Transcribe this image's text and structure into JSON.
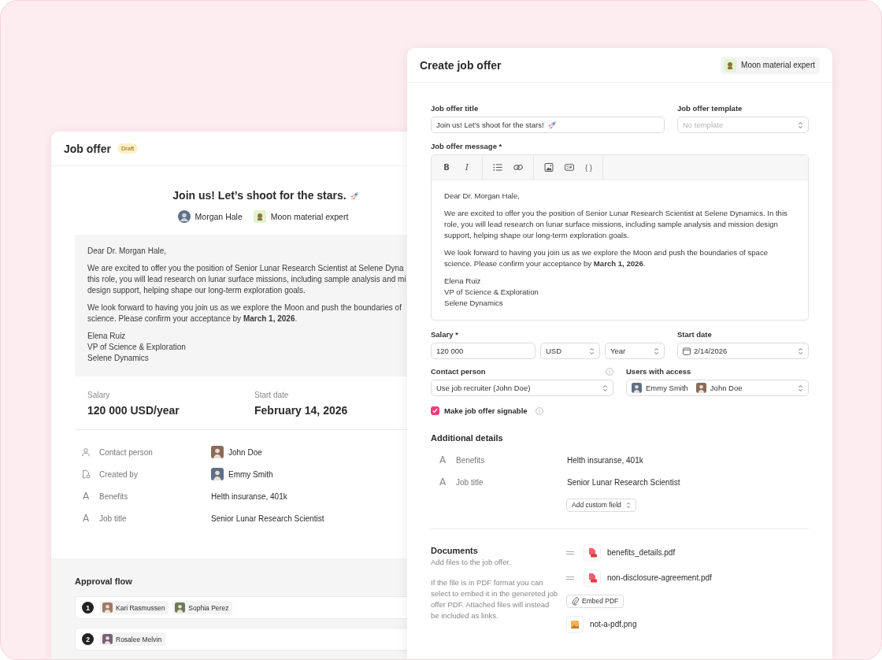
{
  "back_window": {
    "title": "Job offer",
    "badge": "Draft",
    "offer_title": "Join us! Let’s shoot for the stars.",
    "candidate": "Morgan Hale",
    "role": "Moon material expert",
    "letter": [
      {
        "lines": [
          "Dear Dr. Morgan Hale,"
        ]
      },
      {
        "lines": [
          "We are excited to offer you the position of Senior Lunar Research Scientist at Selene Dyna",
          "this role, you will lead research on lunar surface missions, including sample analysis and mi",
          "design support, helping shape our long-term exploration goals."
        ]
      },
      {
        "lines": [
          "We look forward to having you join us as we explore the Moon and push the boundaries of",
          "science. Please confirm your acceptance by **March 1, 2026**."
        ]
      },
      {
        "lines": [
          "Elena Ruiz",
          "VP of Science & Exploration",
          "Selene Dynamics"
        ]
      }
    ],
    "summary": [
      {
        "label": "Salary",
        "value": "120 000 USD/year"
      },
      {
        "label": "Start date",
        "value": "February 14, 2026"
      }
    ],
    "details": [
      {
        "kind": "contact",
        "label": "Contact person",
        "value": "John Doe"
      },
      {
        "kind": "creator",
        "label": "Created by",
        "value": "Emmy Smith"
      },
      {
        "kind": "text",
        "glyph": "A",
        "label": "Benefits",
        "value": "Helth insuranse, 401k"
      },
      {
        "kind": "text",
        "glyph": "A",
        "label": "Job title",
        "value": "Senior Lunar Research Scientist"
      }
    ],
    "approval_flow": {
      "title": "Approval flow",
      "steps": [
        {
          "number": "1",
          "approvers": [
            "Kari Rasmussen",
            "Sophia Perez"
          ]
        },
        {
          "number": "2",
          "approvers": [
            "Rosalee Melvin"
          ]
        }
      ]
    }
  },
  "front_window": {
    "title": "Create job offer",
    "role": "Moon material expert",
    "title_field": {
      "label": "Job offer title",
      "value": "Join us! Let’s shoot for the stars!"
    },
    "template_field": {
      "label": "Job offer template",
      "placeholder": "No template"
    },
    "message": {
      "label": "Job offer message *",
      "toolbar": [
        [
          {
            "kind": "bold",
            "glyph": "B"
          },
          {
            "kind": "italic",
            "glyph": "I"
          }
        ],
        [
          {
            "kind": "list"
          },
          {
            "kind": "link"
          }
        ],
        [
          {
            "kind": "image"
          },
          {
            "kind": "gif"
          },
          {
            "kind": "code",
            "glyph": "{ }"
          }
        ]
      ],
      "paragraphs": [
        [
          "Dear Dr. Morgan Hale,"
        ],
        [
          "We are excited to offer you the position of Senior Lunar Research Scientist at Selene Dynamics. In this role, you will lead research on lunar surface missions, including sample analysis and mission design support, helping shape our long-term exploration goals."
        ],
        [
          "We look forward to having you join us as we explore the Moon and push the boundaries of space science. Please confirm your acceptance by **March 1, 2026**."
        ],
        [
          "Elena Ruiz",
          "VP of Science & Exploration",
          "Selene Dynamics"
        ]
      ]
    },
    "salary": {
      "label": "Salary *",
      "amount": "120 000",
      "currency": "USD",
      "period": "Year"
    },
    "start_date": {
      "label": "Start date",
      "value": "2/14/2026"
    },
    "contact_person": {
      "label": "Contact person",
      "value": "Use job recruiter (John Doe)"
    },
    "users_with_access": {
      "label": "Users with access",
      "users": [
        "Emmy Smith",
        "John Doe"
      ]
    },
    "signable": {
      "label": "Make job offer signable",
      "checked": true
    },
    "additional_details": {
      "title": "Additional details",
      "rows": [
        {
          "glyph": "A",
          "label": "Benefits",
          "value": "Helth insuranse, 401k"
        },
        {
          "glyph": "A",
          "label": "Job title",
          "value": "Senior Lunar Research Scientist"
        }
      ],
      "add_button": "Add custom field"
    },
    "documents": {
      "title": "Documents",
      "description": [
        "Add files to the job offer.",
        "If the file is in PDF format you can select to embed it in the genereted job offer PDF. Attached files will instead be included as links."
      ],
      "embedded_files": [
        {
          "kind": "pdf",
          "name": "benefits_details.pdf"
        },
        {
          "kind": "pdf",
          "name": "non-disclosure-agreement.pdf"
        }
      ],
      "embed_button": "Embed PDF",
      "attached_files": [
        {
          "kind": "image",
          "name": "not-a-pdf.png"
        }
      ]
    }
  }
}
